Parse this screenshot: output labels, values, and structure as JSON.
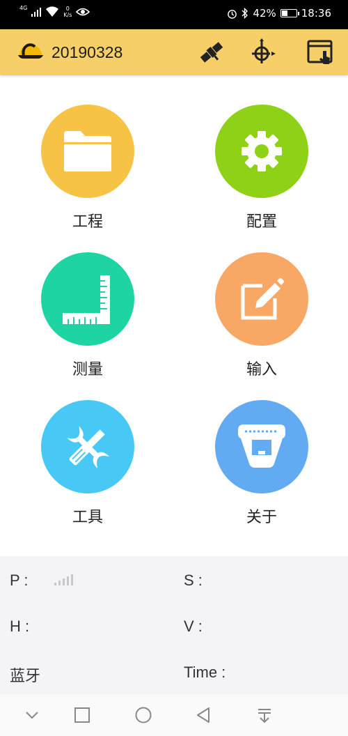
{
  "status_bar": {
    "network": "4G",
    "speed_value": "0",
    "speed_unit": "K/s",
    "battery_percent": "42%",
    "battery_level": 0.42,
    "time": "18:36"
  },
  "app_bar": {
    "title": "20190328",
    "colors": {
      "bar": "#f7cf68"
    }
  },
  "menu": [
    {
      "label": "工程",
      "icon": "folder-icon",
      "color": "#f6c344"
    },
    {
      "label": "配置",
      "icon": "gear-icon",
      "color": "#8fd117"
    },
    {
      "label": "测量",
      "icon": "ruler-icon",
      "color": "#1ed4a3"
    },
    {
      "label": "输入",
      "icon": "edit-icon",
      "color": "#f9a765"
    },
    {
      "label": "工具",
      "icon": "tools-icon",
      "color": "#48c9f5"
    },
    {
      "label": "关于",
      "icon": "receiver-icon",
      "color": "#62abf2"
    }
  ],
  "info": {
    "p_label": "P :",
    "s_label": "S :",
    "h_label": "H :",
    "v_label": "V :",
    "bt_label": "蓝牙",
    "time_label": "Time :"
  }
}
